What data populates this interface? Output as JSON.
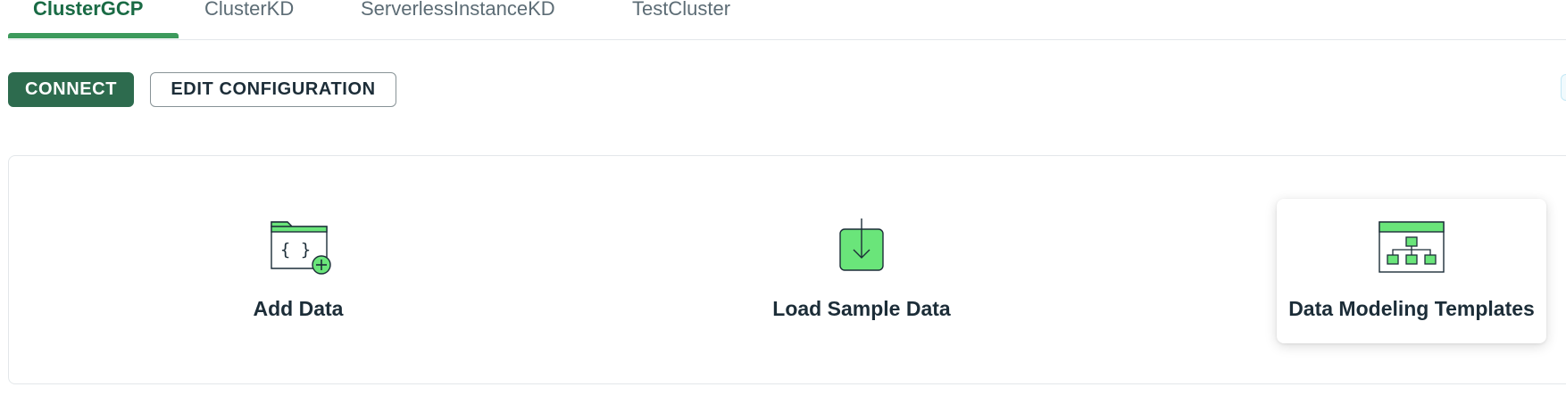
{
  "tabs": [
    {
      "label": "ClusterGCP",
      "active": true
    },
    {
      "label": "ClusterKD",
      "active": false
    },
    {
      "label": "ServerlessInstanceKD",
      "active": false
    },
    {
      "label": "TestCluster",
      "active": false
    }
  ],
  "actions": {
    "connect_label": "CONNECT",
    "edit_label": "EDIT CONFIGURATION"
  },
  "options": [
    {
      "label": "Add Data",
      "icon": "folder-braces-plus-icon"
    },
    {
      "label": "Load Sample Data",
      "icon": "download-arrow-icon"
    },
    {
      "label": "Data Modeling Templates",
      "icon": "schema-diagram-icon"
    }
  ],
  "colors": {
    "accent": "#1a6b45",
    "button_primary": "#2d6b4e",
    "icon_green": "#6ae57a",
    "text": "#1c2d38"
  }
}
